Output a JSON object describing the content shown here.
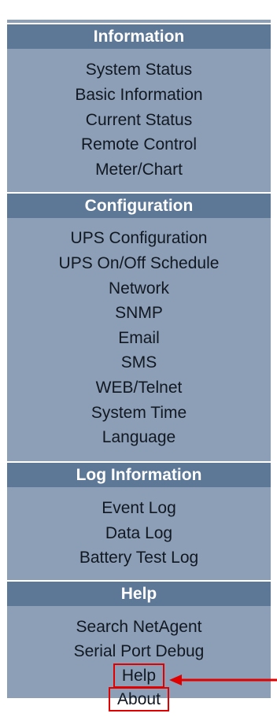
{
  "sections": [
    {
      "title": "Information",
      "items": [
        "System Status",
        "Basic Information",
        "Current Status",
        "Remote Control",
        "Meter/Chart"
      ]
    },
    {
      "title": "Configuration",
      "items": [
        "UPS Configuration",
        "UPS On/Off Schedule",
        "Network",
        "SNMP",
        "Email",
        "SMS",
        "WEB/Telnet",
        "System Time",
        "Language"
      ]
    },
    {
      "title": "Log Information",
      "items": [
        "Event Log",
        "Data Log",
        "Battery Test Log"
      ]
    },
    {
      "title": "Help",
      "items": [
        "Search NetAgent",
        "Serial Port Debug",
        "Help",
        "About"
      ]
    }
  ],
  "annotations": {
    "highlight_color": "#e00000",
    "arrow_icon": "left-arrow-icon",
    "highlighted_items": [
      "Help",
      "About"
    ]
  },
  "colors": {
    "panel_bg": "#8c9fb6",
    "header_bg": "#5d7796",
    "header_text": "#ffffff",
    "item_text": "#111822"
  }
}
